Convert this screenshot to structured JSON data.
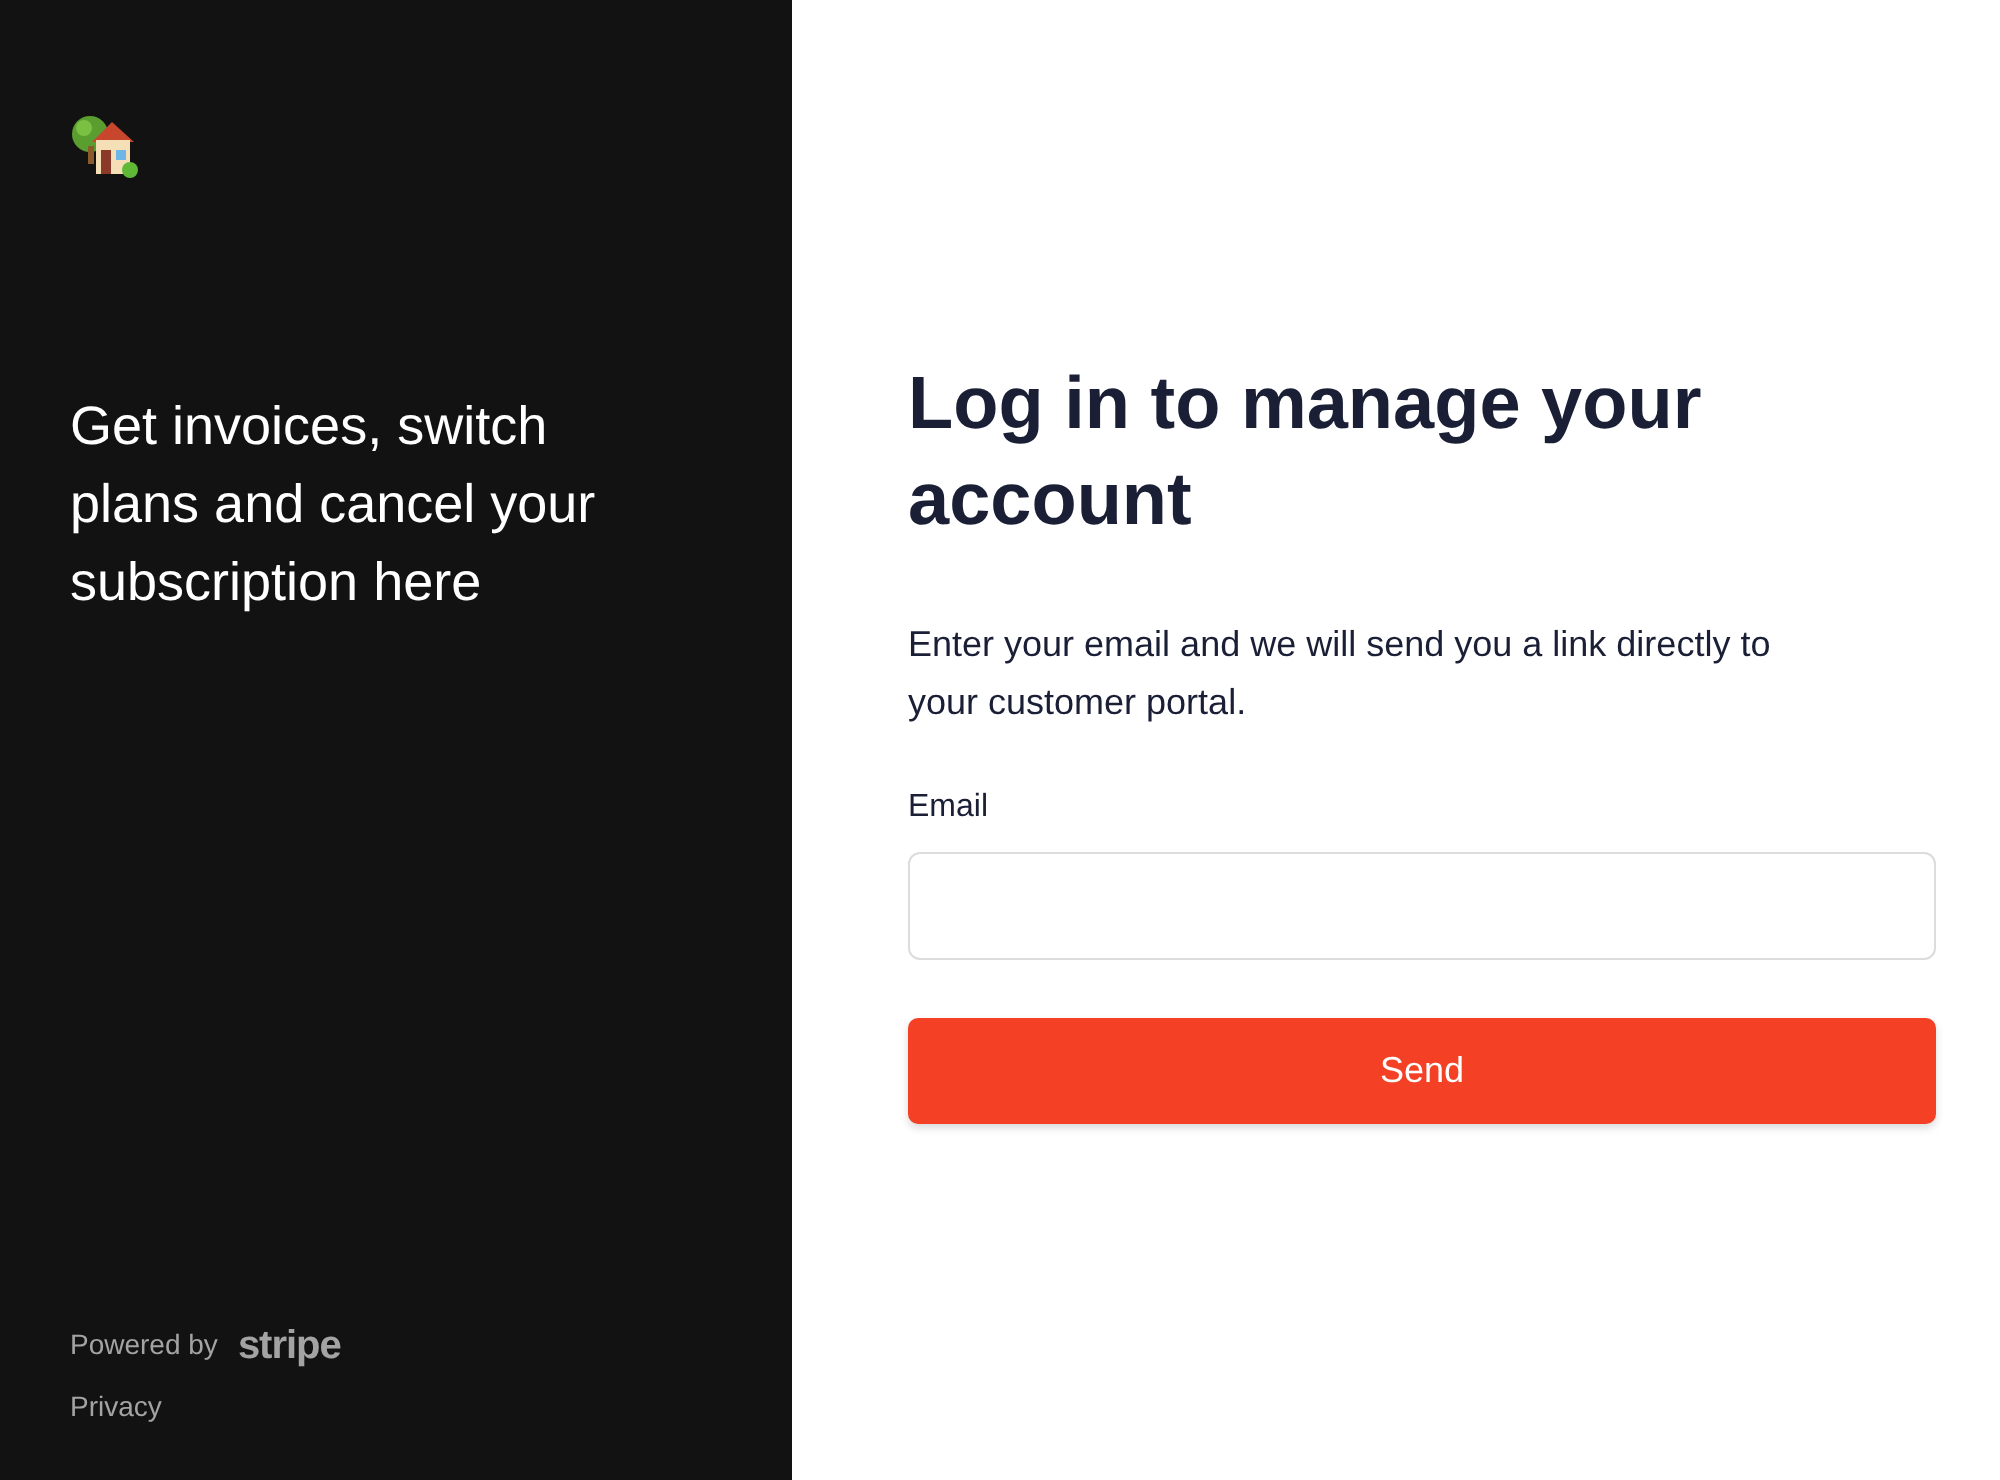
{
  "sidebar": {
    "tagline": "Get invoices, switch plans and cancel your subscription here",
    "footer": {
      "powered_by": "Powered by",
      "brand": "stripe",
      "privacy_link": "Privacy"
    }
  },
  "main": {
    "title": "Log in to manage your account",
    "description": "Enter your email and we will send you a link directly to your customer portal.",
    "email_field": {
      "label": "Email"
    },
    "submit_button": "Send"
  }
}
